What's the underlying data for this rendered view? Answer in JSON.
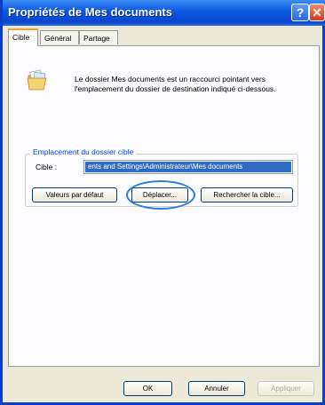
{
  "window": {
    "title": "Propriétés de Mes documents",
    "help_glyph": "?",
    "close_glyph": "✕"
  },
  "tabs": [
    "Cible",
    "Général",
    "Partage"
  ],
  "description": "Le dossier Mes documents est un raccourci pointant vers l'emplacement du dossier de destination indiqué ci-dessous.",
  "group": {
    "title": "Emplacement du dossier cible",
    "target_label": "Cible :",
    "target_value": "ents and Settings\\Administrateur\\Mes documents"
  },
  "buttons": {
    "default": "Valeurs par défaut",
    "move": "Déplacer...",
    "find": "Rechercher la cible..."
  },
  "footer": {
    "ok": "OK",
    "cancel": "Annuler",
    "apply": "Appliquer"
  },
  "colors": {
    "title_bar": "#0a55e0",
    "group_title": "#0046d5",
    "selection": "#316ac5",
    "annotation_circle": "#2a7fd6"
  },
  "icons": {
    "folder": "folder-documents-icon"
  }
}
